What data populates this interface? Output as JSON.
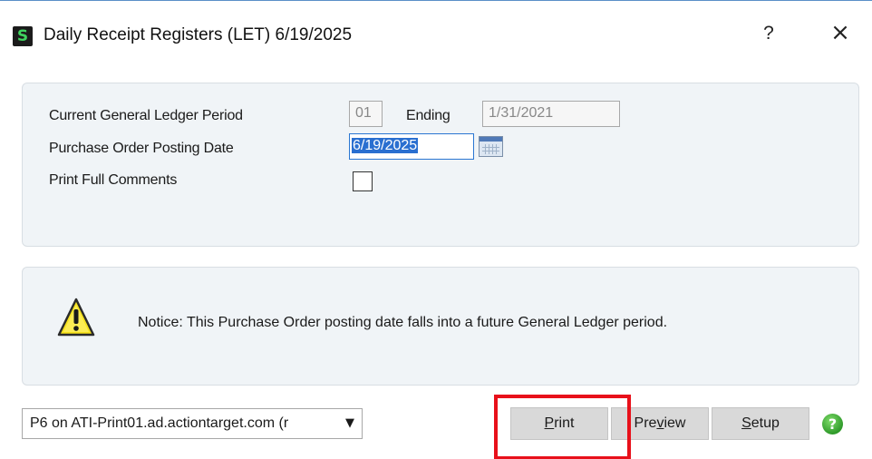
{
  "window": {
    "app_icon_letter": "S",
    "title": "Daily Receipt Registers (LET) 6/19/2025",
    "help_label": "?",
    "close_label": "×"
  },
  "form": {
    "gl_period_label": "Current General Ledger Period",
    "gl_period_value": "01",
    "ending_label": "Ending",
    "ending_value": "1/31/2021",
    "po_posting_date_label": "Purchase Order Posting Date",
    "po_posting_date_value": "6/19/2025",
    "print_full_comments_label": "Print Full Comments",
    "print_full_comments_checked": false
  },
  "notice": {
    "text": "Notice:  This Purchase Order posting date falls into a future General Ledger period.",
    "icon": "warning-icon"
  },
  "footer": {
    "printer_value": "P6 on ATI-Print01.ad.actiontarget.com (r",
    "print_label": "Print",
    "print_mnemonic": "P",
    "print_rest": "rint",
    "preview_pre": "Pre",
    "preview_mnemonic": "v",
    "preview_rest": "iew",
    "setup_mnemonic": "S",
    "setup_rest": "etup",
    "help_glyph": "?"
  },
  "colors": {
    "highlight": "#e8101a",
    "selection": "#2a6fd0",
    "help_green": "#2f9a2a",
    "panel_bg": "#f0f4f7"
  }
}
